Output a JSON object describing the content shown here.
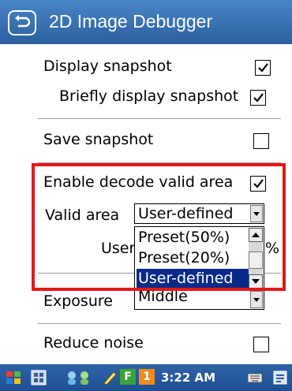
{
  "header": {
    "title": "2D Image Debugger",
    "back_icon": "back-arrow-icon"
  },
  "settings": {
    "display_snapshot": {
      "label": "Display snapshot",
      "checked": true
    },
    "briefly_display_snapshot": {
      "label": "Briefly display snapshot",
      "checked": true
    },
    "save_snapshot": {
      "label": "Save snapshot",
      "checked": false
    },
    "enable_decode_valid_area": {
      "label": "Enable decode valid area",
      "checked": true
    },
    "valid_area": {
      "label": "Valid area",
      "selected": "User-defined",
      "options": [
        "Preset(50%)",
        "Preset(20%)",
        "User-defined"
      ]
    },
    "user_row": {
      "label_partial": "User",
      "suffix": "%"
    },
    "exposure": {
      "label": "Exposure",
      "value": "Middle"
    },
    "reduce_noise": {
      "label": "Reduce noise",
      "checked": false
    }
  },
  "taskbar": {
    "time": "3:22 AM",
    "badge_f": "F",
    "badge_1": "1",
    "icons": [
      "start-flag-icon",
      "app-grid-icon",
      "users-icon",
      "pen-icon",
      "keyboard-icon",
      "input-panel-icon"
    ]
  },
  "colors": {
    "titlebar": "#3a74b8",
    "highlight": "#e31818",
    "selected": "#0a2a8a",
    "taskbar": "#2a5ea3"
  }
}
